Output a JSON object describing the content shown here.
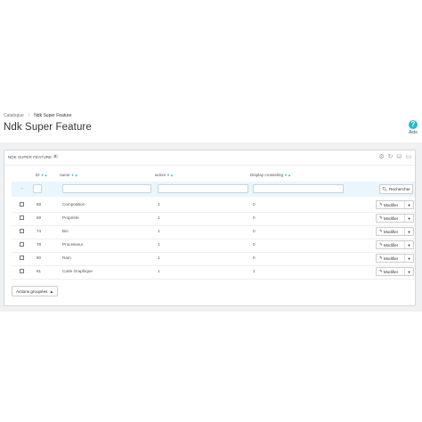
{
  "breadcrumb": [
    "Catalogue",
    "Ndk Super Feature"
  ],
  "page_title": "Ndk Super Feature",
  "help": {
    "label": "Aide",
    "icon": "question-circle-icon"
  },
  "panel": {
    "title": "Ndk Super Feature",
    "count": "6"
  },
  "columns": {
    "id": "ID",
    "name": "name",
    "active": "active",
    "crossell": "Display crosseling"
  },
  "filter": {
    "dash": "--",
    "search_label": "Rechercher"
  },
  "rows": [
    {
      "id": "68",
      "name": "Composition",
      "active": "1",
      "crossell": "0",
      "edit": "Modifier"
    },
    {
      "id": "69",
      "name": "Propriété",
      "active": "1",
      "crossell": "0",
      "edit": "Modifier"
    },
    {
      "id": "74",
      "name": "Bio",
      "active": "1",
      "crossell": "0",
      "edit": "Modifier"
    },
    {
      "id": "78",
      "name": "Processeur",
      "active": "1",
      "crossell": "0",
      "edit": "Modifier"
    },
    {
      "id": "80",
      "name": "Ram",
      "active": "1",
      "crossell": "0",
      "edit": "Modifier"
    },
    {
      "id": "81",
      "name": "Carte Graphique",
      "active": "1",
      "crossell": "1",
      "edit": "Modifier"
    }
  ],
  "bulk_actions": "Actions groupées",
  "colors": {
    "accent": "#25b9d7",
    "filter_bg": "#eaf6fb",
    "page_bg": "#eff1f2"
  }
}
